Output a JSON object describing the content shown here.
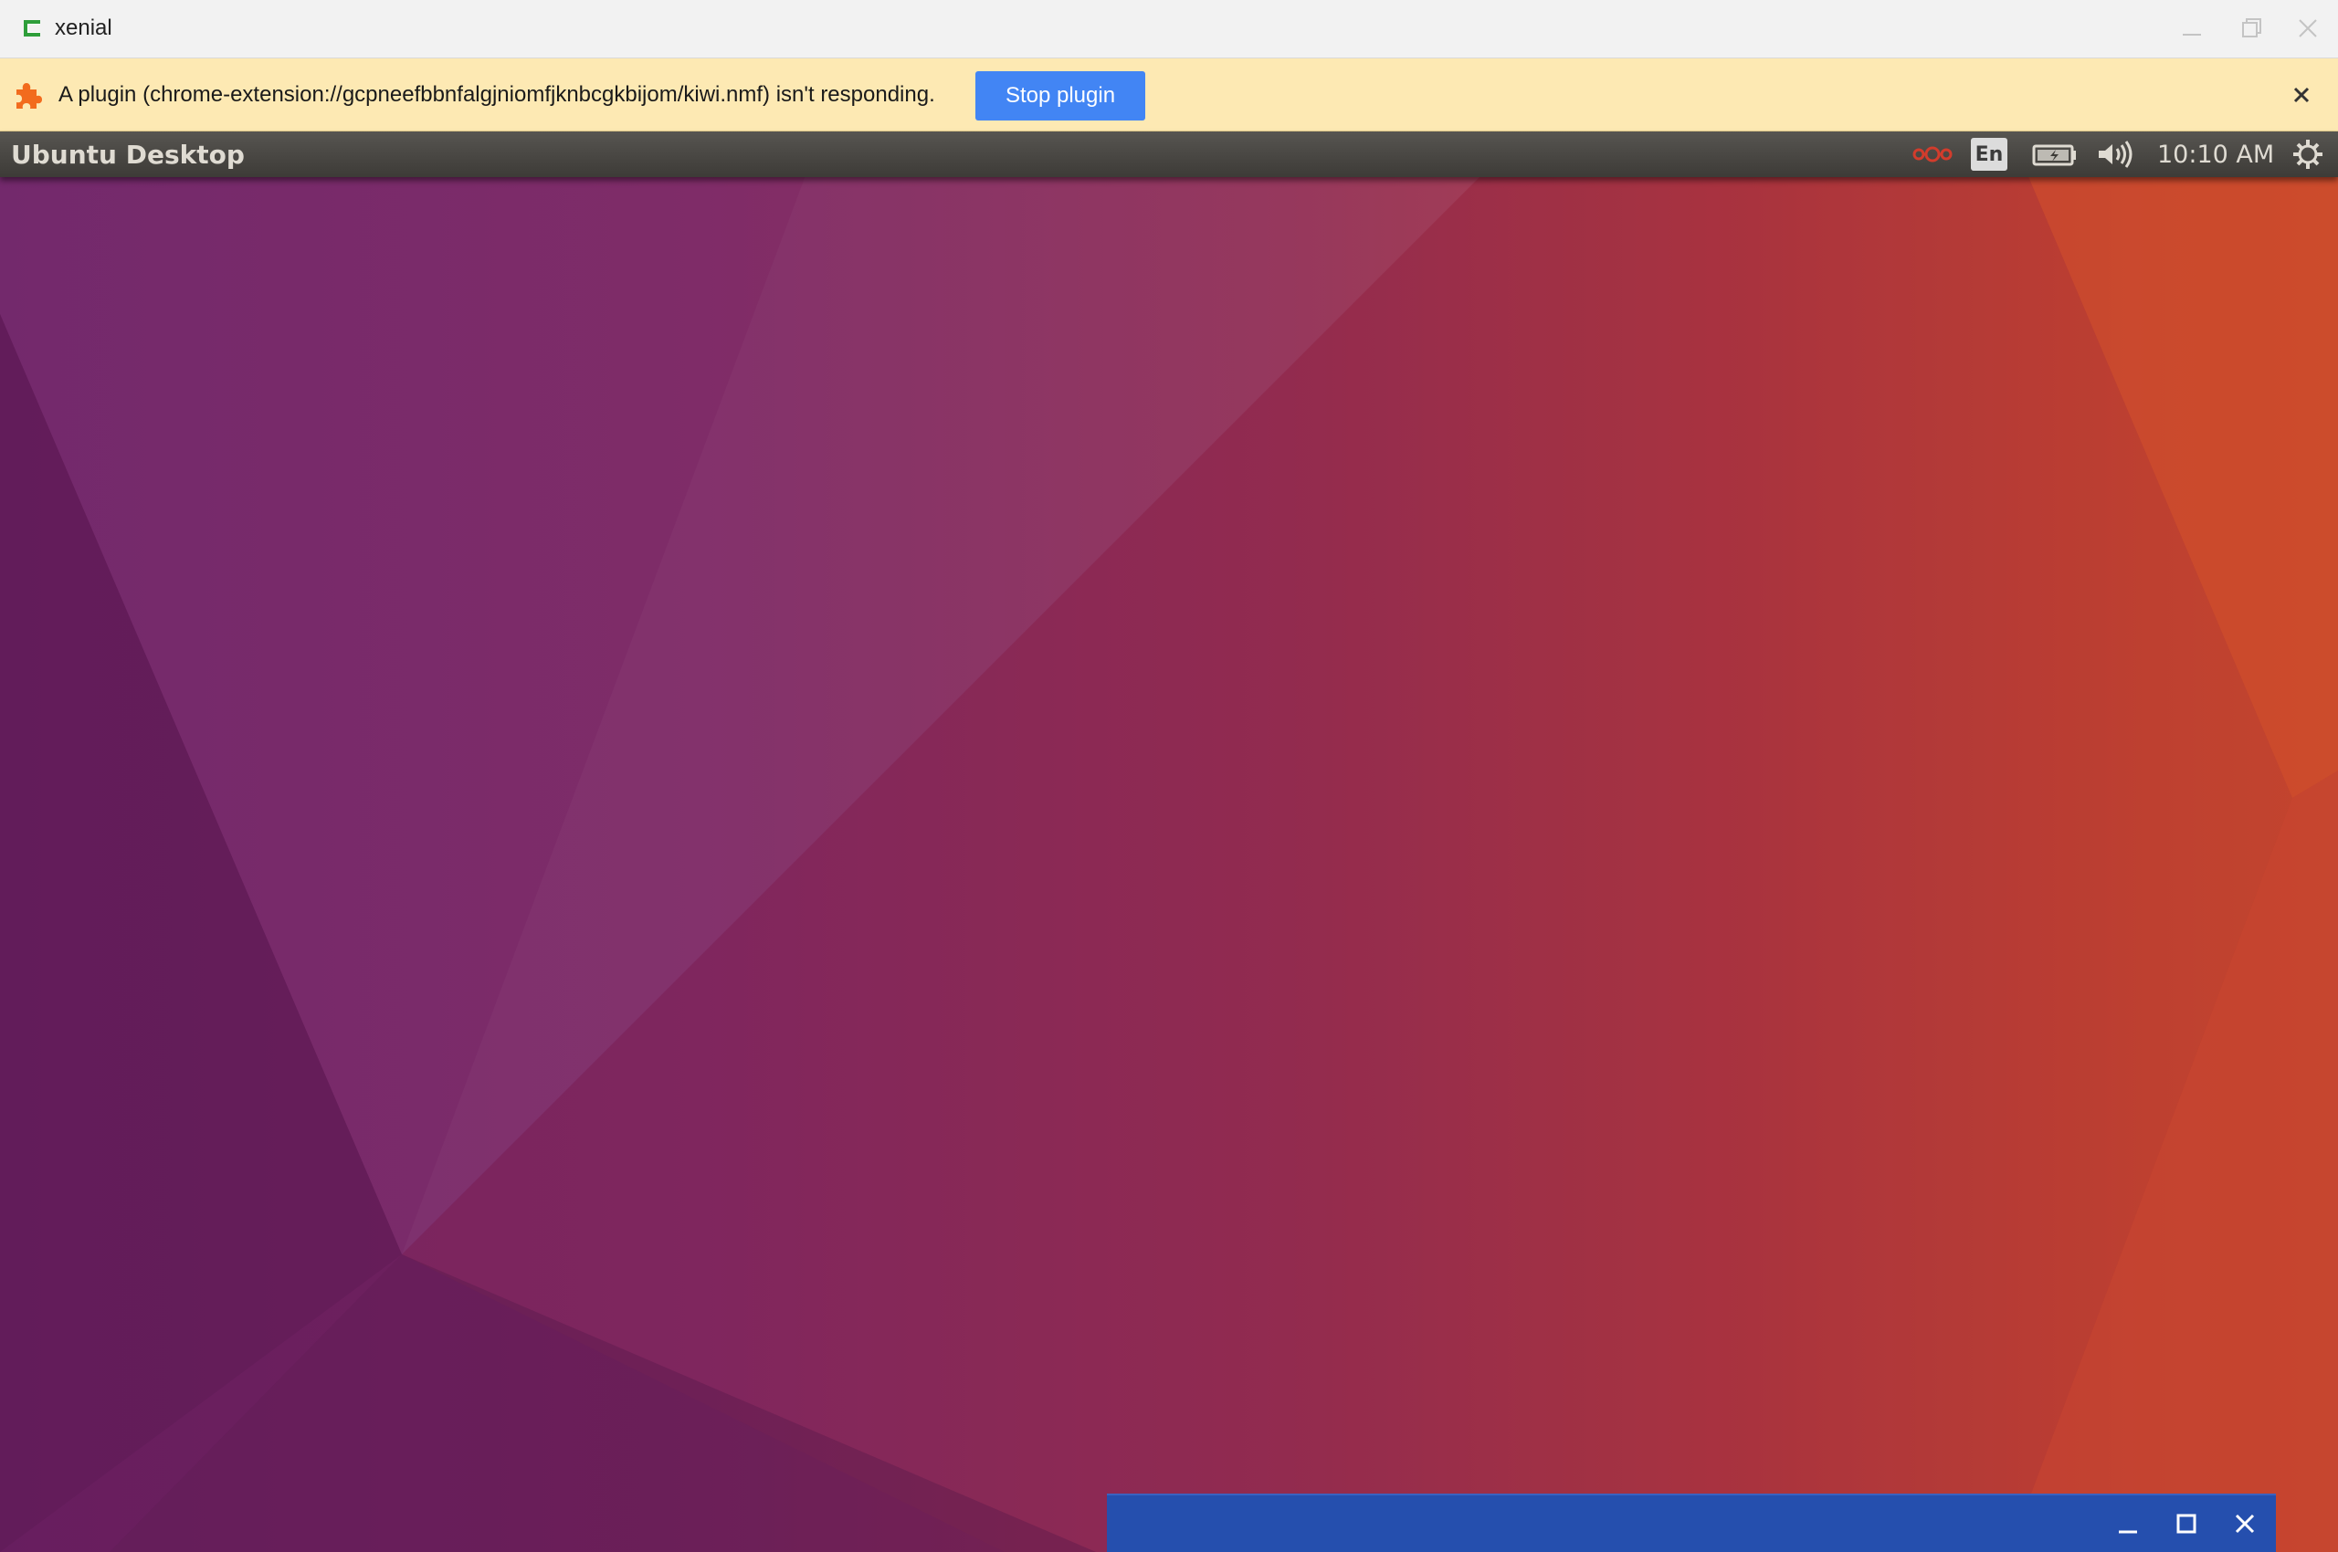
{
  "window": {
    "title": "xenial",
    "icon": "crostini-terminal-icon"
  },
  "infobar": {
    "message": "A plugin (chrome-extension://gcpneefbbnfalgjniomfjknbcgkbijom/kiwi.nmf) isn't responding.",
    "stop_button_label": "Stop plugin",
    "icon": "puzzle-icon"
  },
  "panel": {
    "title": "Ubuntu Desktop",
    "keyboard_layout": "En",
    "clock": "10:10 AM"
  },
  "colors": {
    "infobar_bg": "#fde9b3",
    "accent_button": "#4285f4",
    "panel_bg": "#3d3b37",
    "bottom_window_bar": "#254fae",
    "app_icon_green": "#2e9e3a",
    "puzzle_orange": "#f26b1d"
  }
}
